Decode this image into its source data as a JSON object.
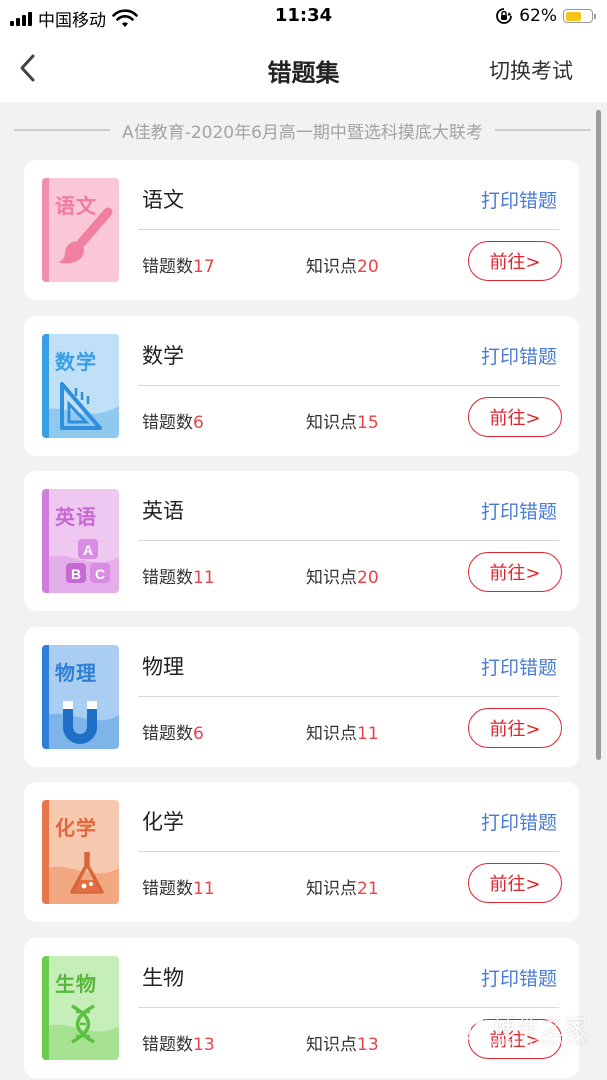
{
  "status_bar": {
    "carrier": "中国移动",
    "time": "11:34",
    "battery_percent": "62%",
    "battery_level": 0.62,
    "icons": [
      "signal-icon",
      "wifi-icon",
      "orientation-lock-icon",
      "battery-icon"
    ]
  },
  "nav": {
    "back_icon": "chevron-left-icon",
    "title": "错题集",
    "switch_exam": "切换考试"
  },
  "exam_title": "A佳教育-2020年6月高一期中暨选科摸底大联考",
  "labels": {
    "print": "打印错题",
    "error_count": "错题数",
    "knowledge_points": "知识点",
    "go": "前往>"
  },
  "subjects": [
    {
      "name": "语文",
      "cover_title": "语文",
      "errors": "17",
      "points": "20",
      "icon": "paintbrush-icon",
      "color": "#f7b6c8",
      "accent": "#f08aa8"
    },
    {
      "name": "数学",
      "cover_title": "数学",
      "errors": "6",
      "points": "15",
      "icon": "ruler-triangle-icon",
      "color": "#b8dcf5",
      "accent": "#3a9ee4"
    },
    {
      "name": "英语",
      "cover_title": "英语",
      "errors": "11",
      "points": "20",
      "icon": "abc-blocks-icon",
      "color": "#ecc0ee",
      "accent": "#c56ad4"
    },
    {
      "name": "物理",
      "cover_title": "物理",
      "errors": "6",
      "points": "11",
      "icon": "magnet-icon",
      "color": "#a9cdf0",
      "accent": "#2f7fd4"
    },
    {
      "name": "化学",
      "cover_title": "化学",
      "errors": "11",
      "points": "21",
      "icon": "flask-icon",
      "color": "#f6c3a6",
      "accent": "#e8764a"
    },
    {
      "name": "生物",
      "cover_title": "生物",
      "errors": "13",
      "points": "13",
      "icon": "dna-icon",
      "color": "#c3ecb5",
      "accent": "#6bcc4f"
    }
  ],
  "watermark": {
    "text": "硬件之家",
    "url": "YINGJIANZHIJIA.COM",
    "icon": "cube-logo-icon"
  }
}
